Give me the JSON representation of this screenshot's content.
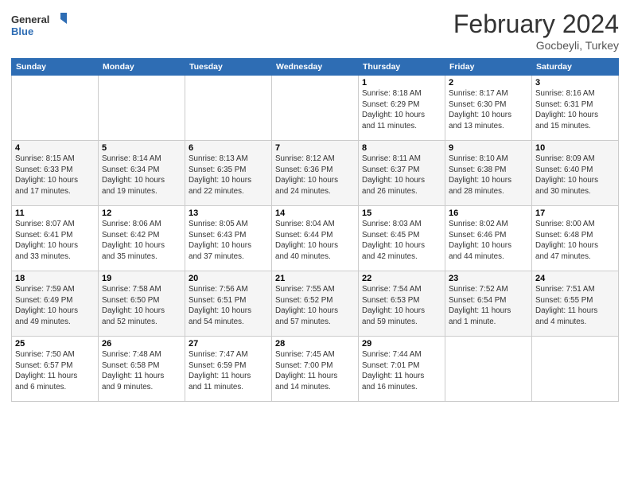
{
  "header": {
    "logo_general": "General",
    "logo_blue": "Blue",
    "month_title": "February 2024",
    "location": "Gocbeyli, Turkey"
  },
  "weekdays": [
    "Sunday",
    "Monday",
    "Tuesday",
    "Wednesday",
    "Thursday",
    "Friday",
    "Saturday"
  ],
  "weeks": [
    [
      {
        "day": "",
        "info": ""
      },
      {
        "day": "",
        "info": ""
      },
      {
        "day": "",
        "info": ""
      },
      {
        "day": "",
        "info": ""
      },
      {
        "day": "1",
        "info": "Sunrise: 8:18 AM\nSunset: 6:29 PM\nDaylight: 10 hours\nand 11 minutes."
      },
      {
        "day": "2",
        "info": "Sunrise: 8:17 AM\nSunset: 6:30 PM\nDaylight: 10 hours\nand 13 minutes."
      },
      {
        "day": "3",
        "info": "Sunrise: 8:16 AM\nSunset: 6:31 PM\nDaylight: 10 hours\nand 15 minutes."
      }
    ],
    [
      {
        "day": "4",
        "info": "Sunrise: 8:15 AM\nSunset: 6:33 PM\nDaylight: 10 hours\nand 17 minutes."
      },
      {
        "day": "5",
        "info": "Sunrise: 8:14 AM\nSunset: 6:34 PM\nDaylight: 10 hours\nand 19 minutes."
      },
      {
        "day": "6",
        "info": "Sunrise: 8:13 AM\nSunset: 6:35 PM\nDaylight: 10 hours\nand 22 minutes."
      },
      {
        "day": "7",
        "info": "Sunrise: 8:12 AM\nSunset: 6:36 PM\nDaylight: 10 hours\nand 24 minutes."
      },
      {
        "day": "8",
        "info": "Sunrise: 8:11 AM\nSunset: 6:37 PM\nDaylight: 10 hours\nand 26 minutes."
      },
      {
        "day": "9",
        "info": "Sunrise: 8:10 AM\nSunset: 6:38 PM\nDaylight: 10 hours\nand 28 minutes."
      },
      {
        "day": "10",
        "info": "Sunrise: 8:09 AM\nSunset: 6:40 PM\nDaylight: 10 hours\nand 30 minutes."
      }
    ],
    [
      {
        "day": "11",
        "info": "Sunrise: 8:07 AM\nSunset: 6:41 PM\nDaylight: 10 hours\nand 33 minutes."
      },
      {
        "day": "12",
        "info": "Sunrise: 8:06 AM\nSunset: 6:42 PM\nDaylight: 10 hours\nand 35 minutes."
      },
      {
        "day": "13",
        "info": "Sunrise: 8:05 AM\nSunset: 6:43 PM\nDaylight: 10 hours\nand 37 minutes."
      },
      {
        "day": "14",
        "info": "Sunrise: 8:04 AM\nSunset: 6:44 PM\nDaylight: 10 hours\nand 40 minutes."
      },
      {
        "day": "15",
        "info": "Sunrise: 8:03 AM\nSunset: 6:45 PM\nDaylight: 10 hours\nand 42 minutes."
      },
      {
        "day": "16",
        "info": "Sunrise: 8:02 AM\nSunset: 6:46 PM\nDaylight: 10 hours\nand 44 minutes."
      },
      {
        "day": "17",
        "info": "Sunrise: 8:00 AM\nSunset: 6:48 PM\nDaylight: 10 hours\nand 47 minutes."
      }
    ],
    [
      {
        "day": "18",
        "info": "Sunrise: 7:59 AM\nSunset: 6:49 PM\nDaylight: 10 hours\nand 49 minutes."
      },
      {
        "day": "19",
        "info": "Sunrise: 7:58 AM\nSunset: 6:50 PM\nDaylight: 10 hours\nand 52 minutes."
      },
      {
        "day": "20",
        "info": "Sunrise: 7:56 AM\nSunset: 6:51 PM\nDaylight: 10 hours\nand 54 minutes."
      },
      {
        "day": "21",
        "info": "Sunrise: 7:55 AM\nSunset: 6:52 PM\nDaylight: 10 hours\nand 57 minutes."
      },
      {
        "day": "22",
        "info": "Sunrise: 7:54 AM\nSunset: 6:53 PM\nDaylight: 10 hours\nand 59 minutes."
      },
      {
        "day": "23",
        "info": "Sunrise: 7:52 AM\nSunset: 6:54 PM\nDaylight: 11 hours\nand 1 minute."
      },
      {
        "day": "24",
        "info": "Sunrise: 7:51 AM\nSunset: 6:55 PM\nDaylight: 11 hours\nand 4 minutes."
      }
    ],
    [
      {
        "day": "25",
        "info": "Sunrise: 7:50 AM\nSunset: 6:57 PM\nDaylight: 11 hours\nand 6 minutes."
      },
      {
        "day": "26",
        "info": "Sunrise: 7:48 AM\nSunset: 6:58 PM\nDaylight: 11 hours\nand 9 minutes."
      },
      {
        "day": "27",
        "info": "Sunrise: 7:47 AM\nSunset: 6:59 PM\nDaylight: 11 hours\nand 11 minutes."
      },
      {
        "day": "28",
        "info": "Sunrise: 7:45 AM\nSunset: 7:00 PM\nDaylight: 11 hours\nand 14 minutes."
      },
      {
        "day": "29",
        "info": "Sunrise: 7:44 AM\nSunset: 7:01 PM\nDaylight: 11 hours\nand 16 minutes."
      },
      {
        "day": "",
        "info": ""
      },
      {
        "day": "",
        "info": ""
      }
    ]
  ]
}
